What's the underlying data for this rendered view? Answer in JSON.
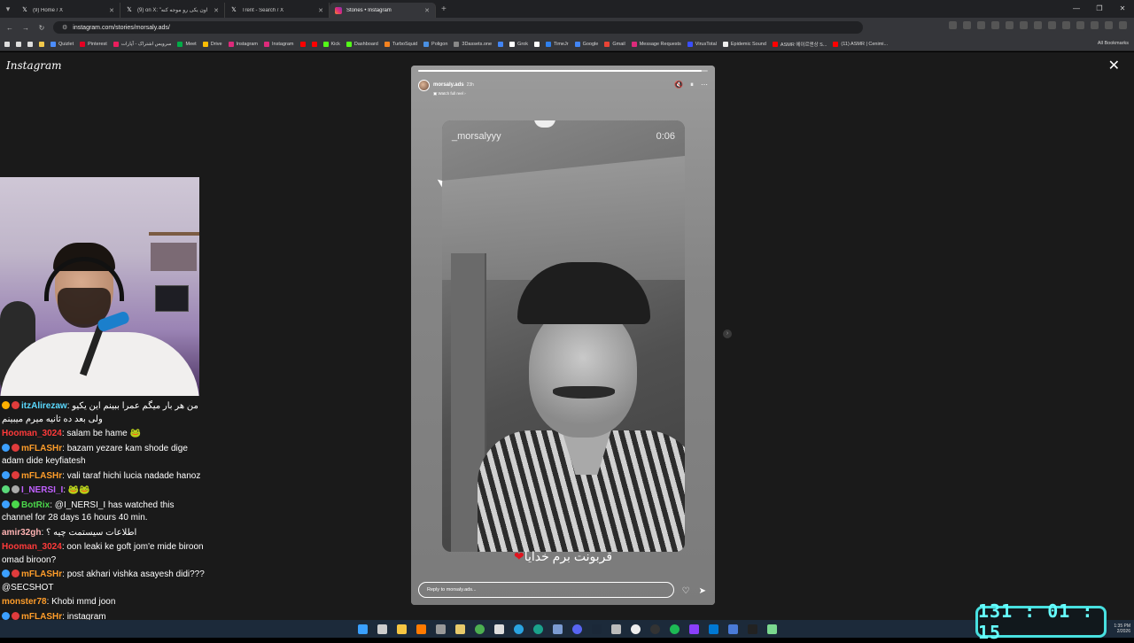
{
  "browser": {
    "tabs": [
      {
        "label": "(9) Home / X",
        "icon": "x-icon",
        "active": false
      },
      {
        "label": "(9) on X: \"اون یکی رو موجه کنه",
        "icon": "x-icon",
        "active": false
      },
      {
        "label": "Trent - Search / X",
        "icon": "x-icon",
        "active": false
      },
      {
        "label": "Stories • Instagram",
        "icon": "instagram-icon",
        "active": true
      }
    ],
    "new_tab": "+",
    "url": "instagram.com/stories/morsaly.ads/",
    "bookmarks": [
      {
        "label": "Quizlet",
        "color": "#4c8dff"
      },
      {
        "label": "Pinterest",
        "color": "#e60023"
      },
      {
        "label": "سرویس اشتراک - آپارات",
        "color": "#ea1d5d"
      },
      {
        "label": "Meet",
        "color": "#00ac47"
      },
      {
        "label": "Drive",
        "color": "#fbbc04"
      },
      {
        "label": "Instagram",
        "color": "#dd2a7b"
      },
      {
        "label": "Instagram",
        "color": "#dd2a7b"
      },
      {
        "label": "",
        "color": "#ff0000"
      },
      {
        "label": "",
        "color": "#ff0000"
      },
      {
        "label": "Kick",
        "color": "#53fc18"
      },
      {
        "label": "Dashboard",
        "color": "#53fc18"
      },
      {
        "label": "TurboSquid",
        "color": "#f5821f"
      },
      {
        "label": "Poligon",
        "color": "#4a90e2"
      },
      {
        "label": "3Dassets.one",
        "color": "#888888"
      },
      {
        "label": "",
        "color": "#4285f4"
      },
      {
        "label": "Grok",
        "color": "#ffffff"
      },
      {
        "label": "",
        "color": "#ffffff"
      },
      {
        "label": "TimeJr",
        "color": "#2f80ed"
      },
      {
        "label": "Google",
        "color": "#4285f4"
      },
      {
        "label": "Gmail",
        "color": "#ea4335"
      },
      {
        "label": "Message Requests",
        "color": "#dd2a7b"
      },
      {
        "label": "VirusTotal",
        "color": "#394eff"
      },
      {
        "label": "Epidemic Sound",
        "color": "#000000"
      },
      {
        "label": "ASMR 에이르앤상 S...",
        "color": "#ff0000"
      },
      {
        "label": "(11) ASMR | Cenimi...",
        "color": "#ff0000"
      }
    ],
    "all_bookmarks": "All Bookmarks"
  },
  "instagram": {
    "logo": "Instagram",
    "story": {
      "username": "morsaly.ads",
      "time_ago": "23h",
      "watch_full_reel": "Watch full reel",
      "progress_fraction": 0.98,
      "video_username": "_morsalyyy",
      "video_time": "0:06",
      "caption": "قربونت برم خدایا",
      "reply_placeholder": "Reply to morsaly.ads..."
    }
  },
  "chat": {
    "messages": [
      {
        "user": "itzAlirezaw",
        "color": "#5ad9ff",
        "text": "من هر بار میگم عمرا ببینم این یکیو ولی بعد ده ثانیه میرم میبینم"
      },
      {
        "user": "Hooman_3024",
        "color": "#ff3a3a",
        "text": "salam be hame"
      },
      {
        "user": "mFLASHr",
        "color": "#ff9d2a",
        "text": "bazam yezare kam shode dige adam dide keyfiatesh"
      },
      {
        "user": "mFLASHr",
        "color": "#ff9d2a",
        "text": "vali taraf hichi lucia nadade hanoz"
      },
      {
        "user": "I_NERSI_I",
        "color": "#c060ff",
        "text": ""
      },
      {
        "user": "BotRix",
        "color": "#4bd84b",
        "text": "@I_NERSI_I has watched this channel for 28 days 16 hours 40 min."
      },
      {
        "user": "amir32gh",
        "color": "#ffb3b3",
        "text": "اطلاعات سیستمت چیه ؟"
      },
      {
        "user": "Hooman_3024",
        "color": "#ff3a3a",
        "text": "oon leaki ke goft jom'e mide biroon omad biroon?"
      },
      {
        "user": "mFLASHr",
        "color": "#ff9d2a",
        "text": "post akhari vishka asayesh didi??? @SECSHOT"
      },
      {
        "user": "monster78",
        "color": "#ff9d2a",
        "text": "Khobi mmd joon"
      },
      {
        "user": "mFLASHr",
        "color": "#ff9d2a",
        "text": "instagram"
      }
    ]
  },
  "taskbar": {
    "icons": [
      "windows-icon",
      "file-icon",
      "folder-icon",
      "search-icon",
      "gear-icon",
      "lock-icon",
      "chrome-icon",
      "wordpad-icon",
      "telegram-icon",
      "edge-icon",
      "app-icon",
      "discord-icon",
      "steam-icon",
      "gamepad-icon",
      "github-icon",
      "obs-icon",
      "spotify-icon",
      "rider-icon",
      "vscode-icon",
      "docs-icon",
      "terminal-icon",
      "notepad-icon"
    ],
    "clock_time": "1:35 PM",
    "clock_date": "2/2026"
  },
  "timer": "131 : 01 : 15"
}
